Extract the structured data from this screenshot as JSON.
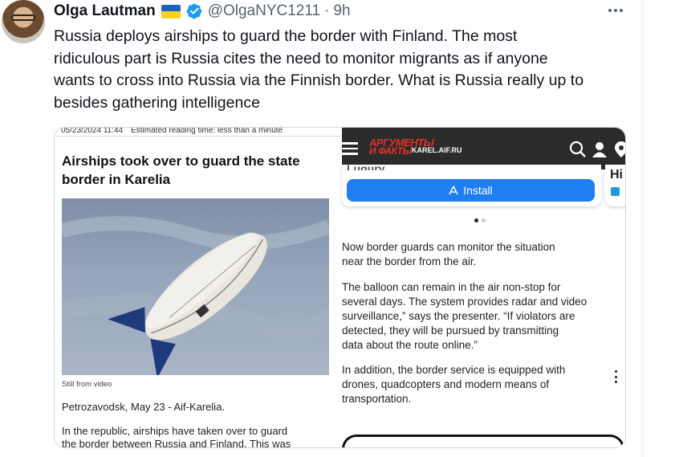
{
  "tweet": {
    "author_name": "Olga Lautman",
    "handle": "@OlgaNYC1211",
    "separator": "·",
    "time": "9h",
    "text_lines": [
      "Russia deploys airships to guard the border with Finland. The most",
      "ridiculous part is Russia cites the need to monitor migrants as if anyone",
      "wants to cross into Russia via the Finnish border. What is Russia really up to",
      "besides gathering intelligence"
    ],
    "icons": [
      "ukraine-flag",
      "verified-badge",
      "more-options-icon"
    ]
  },
  "article": {
    "date": "05/23/2024 11:44",
    "reading_time": "Estimated reading time: less than a minute",
    "title_lines": [
      "Airships took over to guard the state",
      "border in Karelia"
    ],
    "caption": "Still from video",
    "dateline": "Petrozavodsk, May 23 - Aif-Karelia.",
    "body_lines": [
      "In the republic, airships have taken over to guard",
      "the border between Russia and Finland. This was"
    ]
  },
  "app": {
    "logo_line1": "АРГУМЕНТЫ",
    "logo_line2": "И ФАКТЫ",
    "site": "KAREL.AIF.RU",
    "card_peek": "Lugury ... ...",
    "install_label": "Install",
    "side_card_peek": "Hi",
    "para1": [
      "Now border guards can monitor the situation",
      "near the border from the air."
    ],
    "para2": [
      "The balloon can remain in the air non-stop for",
      "several days. The system provides radar and video",
      "surveillance,” says the presenter. “If violators are",
      "detected, they will be pursued by transmitting",
      "data about the route online.”"
    ],
    "para3": [
      "In addition, the border service is equipped with",
      "drones, quadcopters and modern means of",
      "transportation."
    ],
    "pager_count": 2,
    "pager_active": 0
  },
  "colors": {
    "text": "#0f1419",
    "muted": "#536471",
    "verified": "#1d9bf0",
    "install_button": "#1e7ef2",
    "aif_red": "#e2312a"
  }
}
